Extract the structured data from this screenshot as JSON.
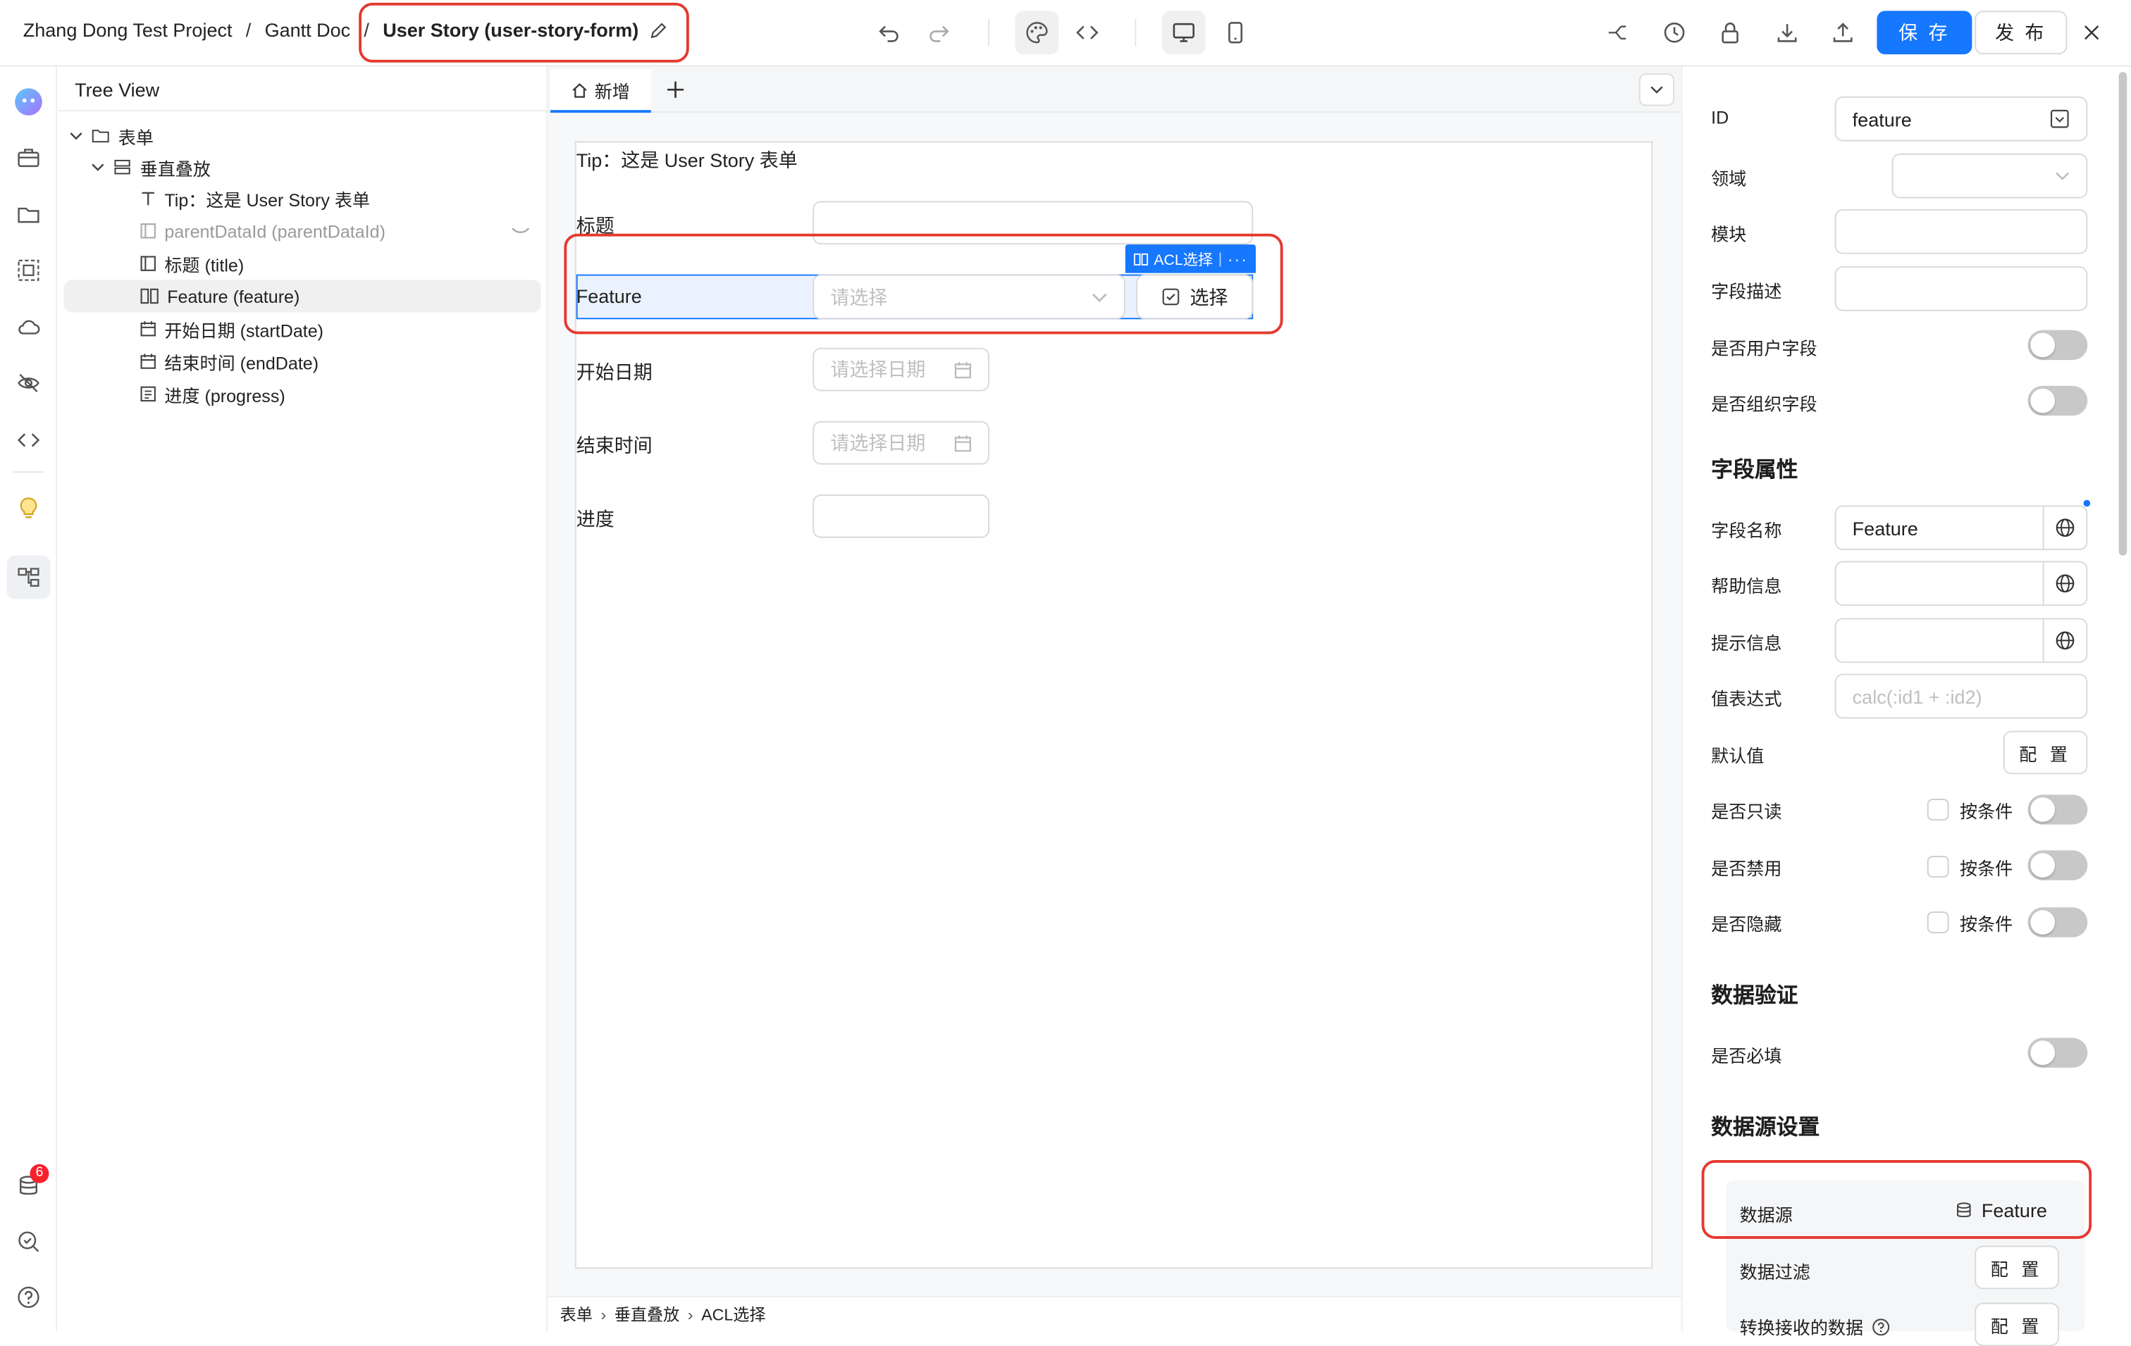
{
  "breadcrumb": {
    "project": "Zhang Dong Test Project",
    "doc": "Gantt Doc",
    "form": "User Story (user-story-form)",
    "sep": "/"
  },
  "toolbar": {
    "save_label": "保 存",
    "publish_label": "发 布"
  },
  "rail": {
    "badge_count": "6"
  },
  "tree": {
    "header": "Tree View",
    "nodes": [
      {
        "label": "表单"
      },
      {
        "label": "垂直叠放"
      },
      {
        "label": "Tip：这是 User Story 表单"
      },
      {
        "label": "parentDataId (parentDataId)"
      },
      {
        "label": "标题 (title)"
      },
      {
        "label": "Feature (feature)"
      },
      {
        "label": "开始日期 (startDate)"
      },
      {
        "label": "结束时间 (endDate)"
      },
      {
        "label": "进度 (progress)"
      }
    ]
  },
  "canvas": {
    "tab_label": "新增",
    "tip": "Tip：这是 User Story 表单",
    "fields": {
      "title_label": "标题",
      "feature_label": "Feature",
      "feature_placeholder": "请选择",
      "feature_select_btn": "选择",
      "acl_tag": "ACL选择",
      "start_label": "开始日期",
      "start_placeholder": "请选择日期",
      "end_label": "结束时间",
      "end_placeholder": "请选择日期",
      "progress_label": "进度"
    },
    "status_path": [
      "表单",
      "垂直叠放",
      "ACL选择"
    ]
  },
  "props": {
    "id_label": "ID",
    "id_value": "feature",
    "domain_label": "领域",
    "module_label": "模块",
    "desc_label": "字段描述",
    "is_user_label": "是否用户字段",
    "is_org_label": "是否组织字段",
    "section_attrs": "字段属性",
    "field_name_label": "字段名称",
    "field_name_value": "Feature",
    "help_label": "帮助信息",
    "hint_label": "提示信息",
    "expr_label": "值表达式",
    "expr_placeholder": "calc(:id1 + :id2)",
    "default_label": "默认值",
    "config_btn": "配 置",
    "readonly_label": "是否只读",
    "disabled_label": "是否禁用",
    "hidden_label": "是否隐藏",
    "by_condition": "按条件",
    "section_validate": "数据验证",
    "required_label": "是否必填",
    "section_datasource": "数据源设置",
    "datasource_label": "数据源",
    "datasource_value": "Feature",
    "filter_label": "数据过滤",
    "convert_label": "转换接收的数据"
  },
  "colors": {
    "accent": "#1677ff",
    "highlight": "#e5392f",
    "badge": "#f5222d"
  }
}
